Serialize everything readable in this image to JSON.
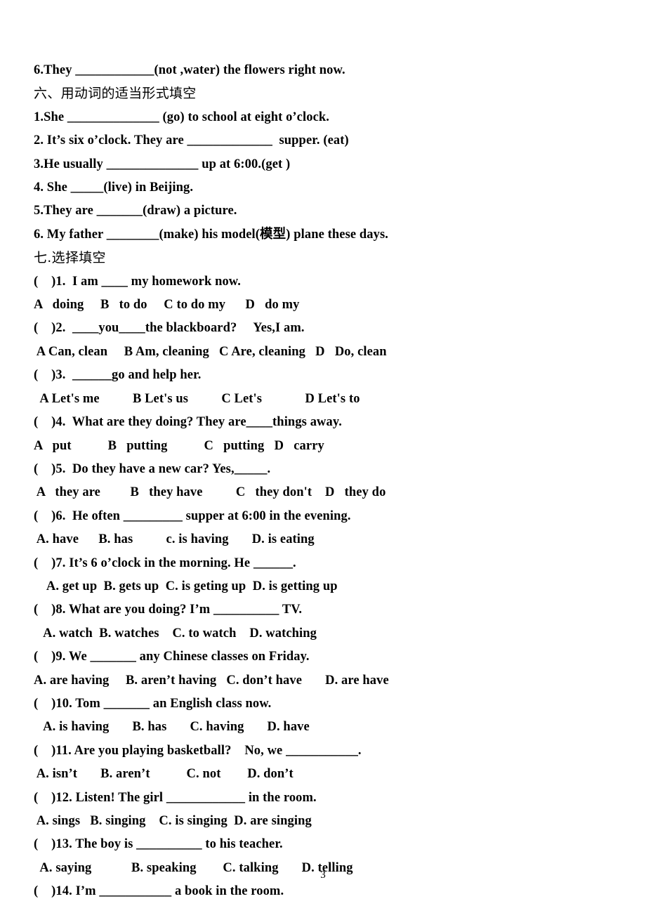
{
  "document": {
    "page_number": "3",
    "background_color": "#ffffff",
    "text_color": "#000000"
  },
  "lines": [
    {
      "id": "fill-q6-prev",
      "text": "6.They ____________(not ,water) the flowers right now.",
      "kind": "question",
      "indent": 0
    },
    {
      "id": "section-six-heading",
      "text": "六、用动词的适当形式填空",
      "kind": "heading-cn",
      "indent": 0
    },
    {
      "id": "six-q1",
      "text": "1.She ______________ (go) to school at eight o’clock.",
      "kind": "question",
      "indent": 0
    },
    {
      "id": "six-q2",
      "text": "2. It’s six o’clock. They are _____________  supper. (eat)",
      "kind": "question",
      "indent": 0
    },
    {
      "id": "six-q3",
      "text": "3.He usually ______________ up at 6:00.(get )",
      "kind": "question",
      "indent": 0
    },
    {
      "id": "six-q4",
      "text": "4. She _____(live) in Beijing.",
      "kind": "question",
      "indent": 0
    },
    {
      "id": "six-q5",
      "text": "5.They are _______(draw) a picture.",
      "kind": "question",
      "indent": 0
    },
    {
      "id": "six-q6",
      "text": "6. My father ________(make) his model(模型) plane these days.",
      "kind": "question",
      "indent": 0
    },
    {
      "id": "section-seven-heading",
      "text": "七.选择填空",
      "kind": "heading-cn",
      "indent": 0
    },
    {
      "id": "seven-q1",
      "text": "(    )1.  I am ____ my homework now.",
      "kind": "question",
      "indent": 0
    },
    {
      "id": "seven-q1-options",
      "text": "A   doing     B   to do     C to do my      D   do my",
      "kind": "options",
      "indent": 0
    },
    {
      "id": "seven-q2",
      "text": "(    )2.  ____you____the blackboard?     Yes,I am.",
      "kind": "question",
      "indent": 0
    },
    {
      "id": "seven-q2-options",
      "text": " A Can, clean     B Am, cleaning   C Are, cleaning   D   Do, clean",
      "kind": "options",
      "indent": 0
    },
    {
      "id": "seven-q3",
      "text": "(    )3.  ______go and help her.",
      "kind": "question",
      "indent": 0
    },
    {
      "id": "seven-q3-options",
      "text": "  A Let's me          B Let's us          C Let's             D Let's to",
      "kind": "options",
      "indent": 0
    },
    {
      "id": "seven-q4",
      "text": "(    )4.  What are they doing? They are____things away.",
      "kind": "question",
      "indent": 0
    },
    {
      "id": "seven-q4-options",
      "text": "A   put           B   putting           C   putting   D   carry",
      "kind": "options",
      "indent": 0
    },
    {
      "id": "seven-q5",
      "text": "(    )5.  Do they have a new car? Yes,_____.",
      "kind": "question",
      "indent": 0
    },
    {
      "id": "seven-q5-options",
      "text": " A   they are         B   they have          C   they don't    D   they do",
      "kind": "options",
      "indent": 0
    },
    {
      "id": "seven-q6",
      "text": "(    )6.  He often _________ supper at 6:00 in the evening.",
      "kind": "question",
      "indent": 0
    },
    {
      "id": "seven-q6-options",
      "text": " A. have      B. has          c. is having       D. is eating",
      "kind": "options",
      "indent": 0
    },
    {
      "id": "seven-q7",
      "text": "(    )7. It’s 6 o’clock in the morning. He ______.",
      "kind": "question",
      "indent": 0
    },
    {
      "id": "seven-q7-options",
      "text": "    A. get up  B. gets up  C. is geting up  D. is getting up",
      "kind": "options",
      "indent": 0
    },
    {
      "id": "seven-q8",
      "text": "(    )8. What are you doing? I’m __________ TV.",
      "kind": "question",
      "indent": 0
    },
    {
      "id": "seven-q8-options",
      "text": "   A. watch  B. watches    C. to watch    D. watching",
      "kind": "options",
      "indent": 0
    },
    {
      "id": "seven-q9",
      "text": "(    )9. We _______ any Chinese classes on Friday.",
      "kind": "question",
      "indent": 0
    },
    {
      "id": "seven-q9-options",
      "text": "A. are having     B. aren’t having   C. don’t have       D. are have",
      "kind": "options",
      "indent": 0
    },
    {
      "id": "seven-q10",
      "text": "(    )10. Tom _______ an English class now.",
      "kind": "question",
      "indent": 0
    },
    {
      "id": "seven-q10-options",
      "text": "   A. is having       B. has       C. having       D. have",
      "kind": "options",
      "indent": 0
    },
    {
      "id": "seven-q11",
      "text": "(    )11. Are you playing basketball?    No, we ___________.",
      "kind": "question",
      "indent": 0
    },
    {
      "id": "seven-q11-options",
      "text": " A. isn’t       B. aren’t           C. not        D. don’t",
      "kind": "options",
      "indent": 0
    },
    {
      "id": "seven-q12",
      "text": "(    )12. Listen! The girl ____________ in the room.",
      "kind": "question",
      "indent": 0
    },
    {
      "id": "seven-q12-options",
      "text": " A. sings   B. singing    C. is singing  D. are singing",
      "kind": "options",
      "indent": 0
    },
    {
      "id": "seven-q13",
      "text": "(    )13. The boy is __________ to his teacher.",
      "kind": "question",
      "indent": 0
    },
    {
      "id": "seven-q13-options",
      "text": "  A. saying            B. speaking        C. talking       D. telling",
      "kind": "options",
      "indent": 0
    },
    {
      "id": "seven-q14",
      "text": "(    )14. I’m ___________ a book in the room.",
      "kind": "question",
      "indent": 0
    }
  ]
}
